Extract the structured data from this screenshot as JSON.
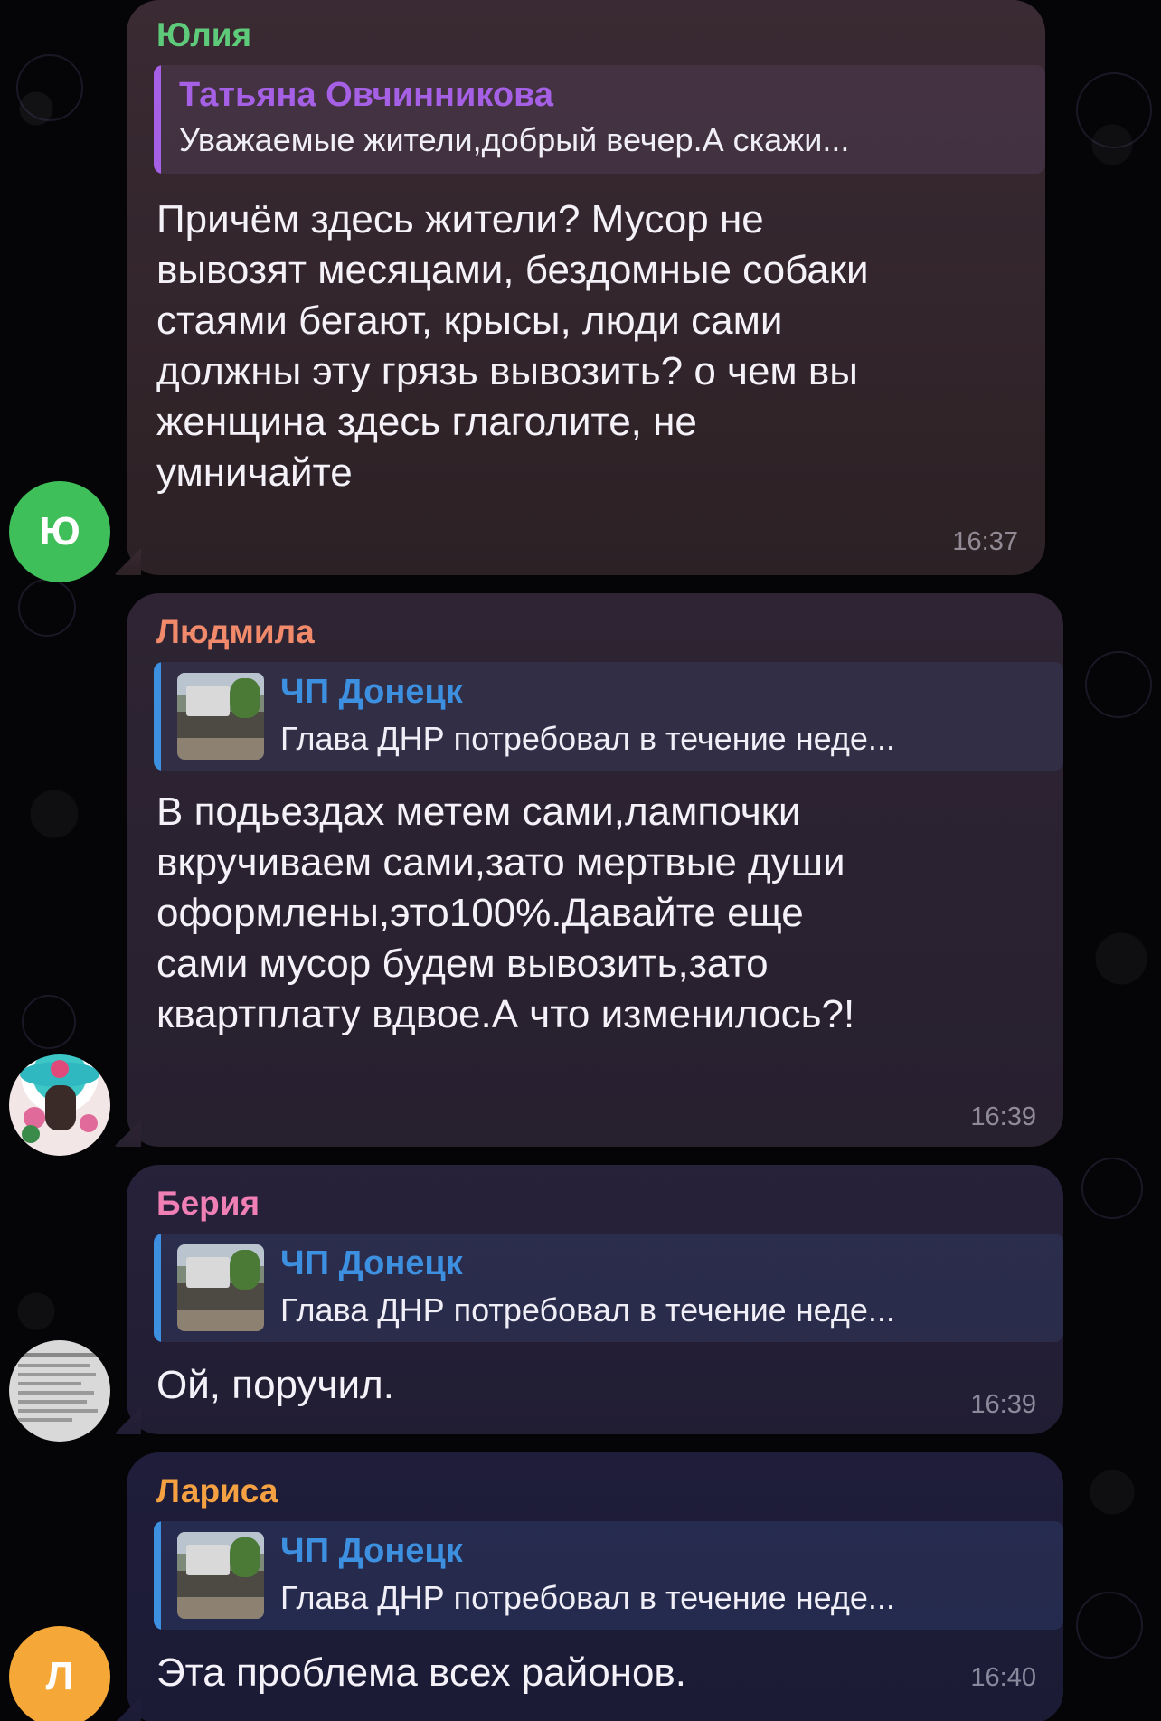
{
  "messages": [
    {
      "sender": "Юлия",
      "sender_color": "#5ecb7a",
      "avatar_text": "Ю",
      "avatar_color": "#3fbf59",
      "reply": {
        "title": "Татьяна Овчинникова",
        "text": "Уважаемые жители,добрый вечер.А скажи...",
        "accent": "#a560e6"
      },
      "text": "Причём здесь жители? Мусор не\nвывозят месяцами, бездомные собаки\nстаями бегают, крысы, люди сами\nдолжны эту грязь вывозить? о чем вы\nженщина здесь глаголите, не\nумничайте",
      "time": "16:37"
    },
    {
      "sender": "Людмила",
      "sender_color": "#f08a6b",
      "avatar_text": "",
      "reply": {
        "title": "ЧП Донецк",
        "text": "Глава ДНР потребовал в течение неде...",
        "accent": "#3d8fe0"
      },
      "text": "В подьездах метем сами,лампочки\nвкручиваем сами,зато мертвые души\nоформлены,это100%.Давайте еще\nсами мусор будем вывозить,зато\nквартплату вдвое.А что изменилось?!",
      "time": "16:39"
    },
    {
      "sender": "Берия",
      "sender_color": "#ef7fb4",
      "avatar_text": "",
      "reply": {
        "title": "ЧП Донецк",
        "text": "Глава ДНР потребовал в течение неде...",
        "accent": "#3d8fe0"
      },
      "text": "Ой, поручил.",
      "time": "16:39"
    },
    {
      "sender": "Лариса",
      "sender_color": "#f5a142",
      "avatar_text": "Л",
      "avatar_color": "#f5a838",
      "reply": {
        "title": "ЧП Донецк",
        "text": "Глава ДНР потребовал в течение неде...",
        "accent": "#3d8fe0"
      },
      "text": "Эта проблема всех районов.",
      "time": "16:40"
    }
  ]
}
